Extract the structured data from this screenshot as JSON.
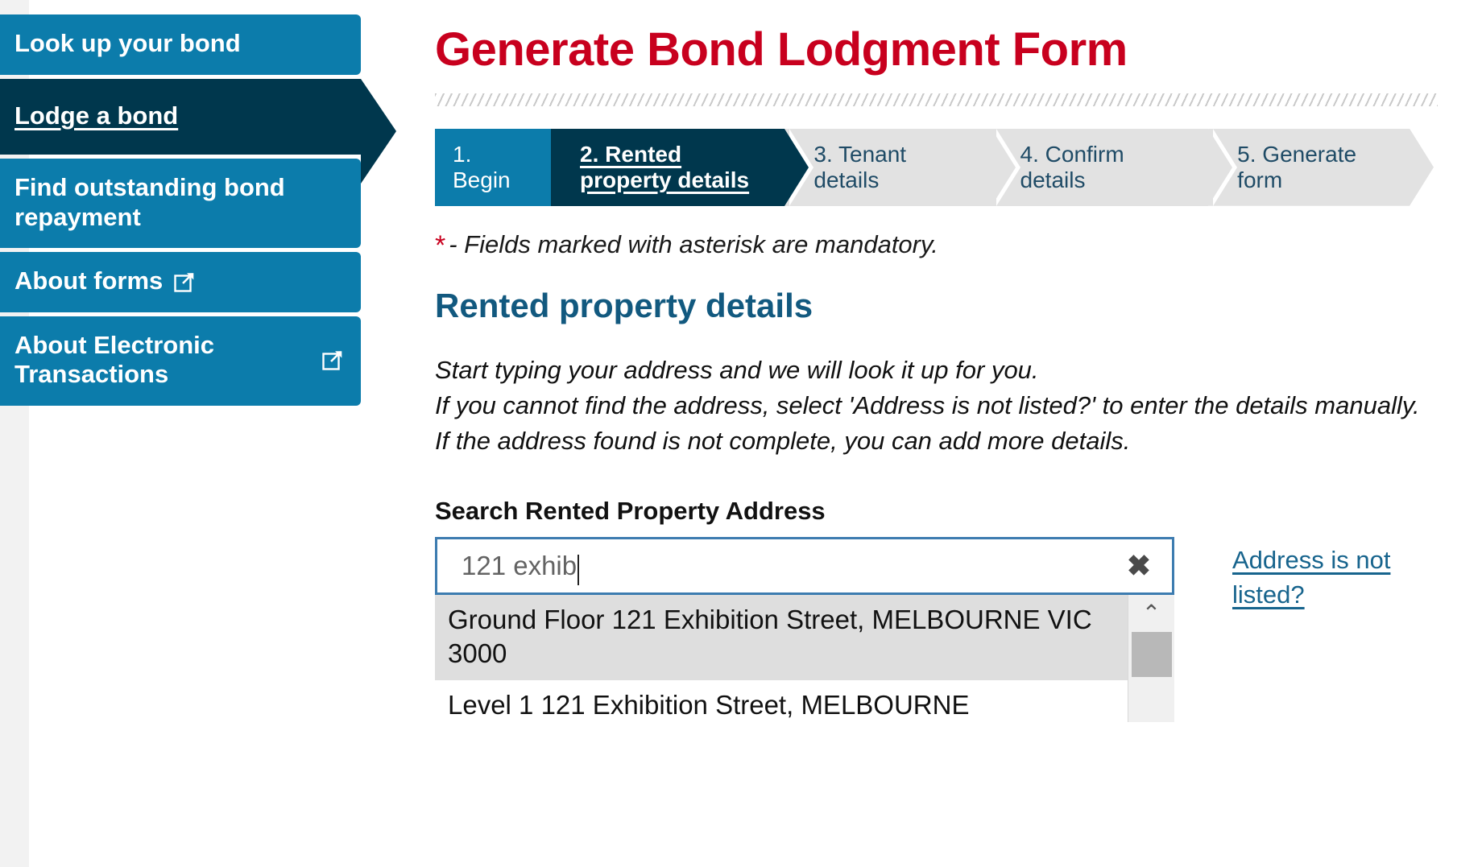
{
  "sidebar": {
    "items": [
      {
        "label": "Look up your bond",
        "active": false,
        "external": false
      },
      {
        "label": "Lodge a bond",
        "active": true,
        "external": false
      },
      {
        "label": "Find outstanding bond repayment",
        "active": false,
        "external": false
      },
      {
        "label": "About forms",
        "active": false,
        "external": true
      },
      {
        "label": "About Electronic Transactions",
        "active": false,
        "external": true
      }
    ]
  },
  "header": {
    "title": "Generate Bond Lodgment Form"
  },
  "steps": [
    {
      "label": "1. Begin",
      "state": "done"
    },
    {
      "label": "2. Rented property details",
      "state": "current"
    },
    {
      "label": "3. Tenant details",
      "state": "todo"
    },
    {
      "label": "4. Confirm details",
      "state": "todo"
    },
    {
      "label": "5. Generate form",
      "state": "todo"
    }
  ],
  "mandatory": {
    "asterisk": "*",
    "text": "- Fields marked with asterisk are mandatory."
  },
  "section": {
    "heading": "Rented property details",
    "intro_lines": [
      "Start typing your address and we will look it up for you.",
      "If you cannot find the address, select 'Address is not listed?' to enter the details manually.",
      "If the address found is not complete, you can add more details."
    ]
  },
  "search": {
    "label": "Search Rented Property Address",
    "value": "121 exhib",
    "placeholder": "Search Rented Property Address",
    "clear_icon": "✖",
    "not_listed_link": "Address is not listed?",
    "scroll_up_icon": "⌃",
    "suggestions": [
      {
        "text": "Ground Floor 121 Exhibition Street, MELBOURNE VIC 3000",
        "highlighted": true
      },
      {
        "text": "Level 1 121 Exhibition Street, MELBOURNE",
        "highlighted": false
      }
    ]
  },
  "colors": {
    "nav_blue": "#0c7cab",
    "nav_active": "#00374d",
    "title_red": "#c8001e",
    "heading_blue": "#12597f",
    "link_blue": "#17648d",
    "step_inactive": "#e2e2e2",
    "input_border": "#3d7cb0",
    "suggest_highlight": "#dedede"
  }
}
